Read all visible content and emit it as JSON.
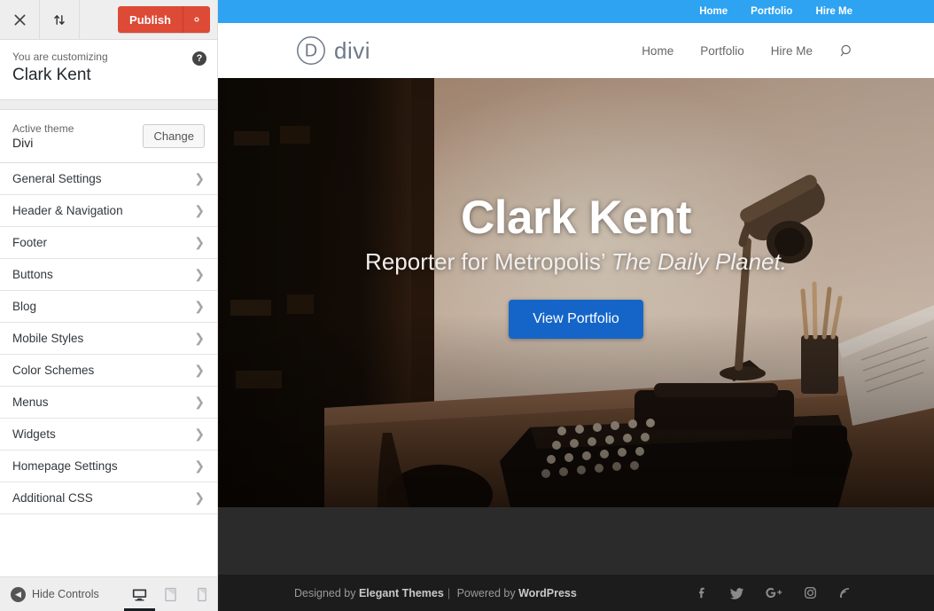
{
  "customizer": {
    "topbar": {
      "close_icon": "close-icon",
      "swap_icon": "collapse-expand-icon",
      "publish_label": "Publish",
      "gear_icon": "gear-icon"
    },
    "info": {
      "subtitle": "You are customizing",
      "title": "Clark Kent",
      "help_icon": "help-icon",
      "help_glyph": "?"
    },
    "theme": {
      "label": "Active theme",
      "name": "Divi",
      "change_label": "Change"
    },
    "sections": [
      {
        "label": "General Settings"
      },
      {
        "label": "Header & Navigation"
      },
      {
        "label": "Footer"
      },
      {
        "label": "Buttons"
      },
      {
        "label": "Blog"
      },
      {
        "label": "Mobile Styles"
      },
      {
        "label": "Color Schemes"
      },
      {
        "label": "Menus"
      },
      {
        "label": "Widgets"
      },
      {
        "label": "Homepage Settings"
      },
      {
        "label": "Additional CSS"
      }
    ],
    "bottom": {
      "hide_controls_label": "Hide Controls",
      "devices": [
        {
          "name": "desktop",
          "active": true
        },
        {
          "name": "tablet",
          "active": false
        },
        {
          "name": "mobile",
          "active": false
        }
      ]
    }
  },
  "preview": {
    "admin_bar": {
      "links": [
        "Home",
        "Portfolio",
        "Hire Me"
      ]
    },
    "site_header": {
      "logo_mark": "D",
      "logo_text": "divi",
      "nav": [
        "Home",
        "Portfolio",
        "Hire Me"
      ],
      "search_icon": "search-icon"
    },
    "hero": {
      "title": "Clark Kent",
      "subtitle_prefix": "Reporter for Metropolis’ ",
      "subtitle_italic": "The Daily Planet.",
      "button_label": "View Portfolio"
    },
    "footer": {
      "credit_prefix": "Designed by ",
      "credit_brand": "Elegant Themes",
      "credit_sep": "|",
      "credit_mid": " Powered by ",
      "credit_platform": "WordPress",
      "social": [
        "facebook-icon",
        "twitter-icon",
        "google-plus-icon",
        "instagram-icon",
        "rss-icon"
      ]
    }
  },
  "colors": {
    "publish_red": "#dd4a36",
    "admin_blue": "#2ea3f2",
    "cta_blue": "#1565c9",
    "footer_dark": "#1c1c1c",
    "band_dark": "#2b2b2b"
  }
}
